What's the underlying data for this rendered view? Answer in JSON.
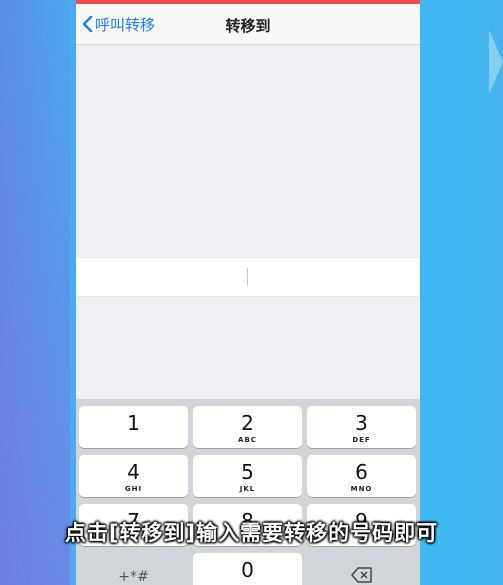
{
  "navbar": {
    "back_label": "呼叫转移",
    "title": "转移到"
  },
  "keypad": {
    "keys": [
      {
        "digit": "1",
        "letters": ""
      },
      {
        "digit": "2",
        "letters": "ABC"
      },
      {
        "digit": "3",
        "letters": "DEF"
      },
      {
        "digit": "4",
        "letters": "GHI"
      },
      {
        "digit": "5",
        "letters": "JKL"
      },
      {
        "digit": "6",
        "letters": "MNO"
      },
      {
        "digit": "7",
        "letters": ""
      },
      {
        "digit": "8",
        "letters": ""
      },
      {
        "digit": "9",
        "letters": ""
      },
      {
        "digit": "+*#",
        "letters": ""
      },
      {
        "digit": "0",
        "letters": ""
      }
    ]
  },
  "caption": "点击[转移到]输入需要转移的号码即可",
  "colors": {
    "accent": "#1a7df5",
    "status_strip": "#f24a4a",
    "keypad_bg": "#d1d4d9"
  },
  "icons": {
    "back": "chevron-left-icon",
    "delete": "backspace-icon"
  }
}
